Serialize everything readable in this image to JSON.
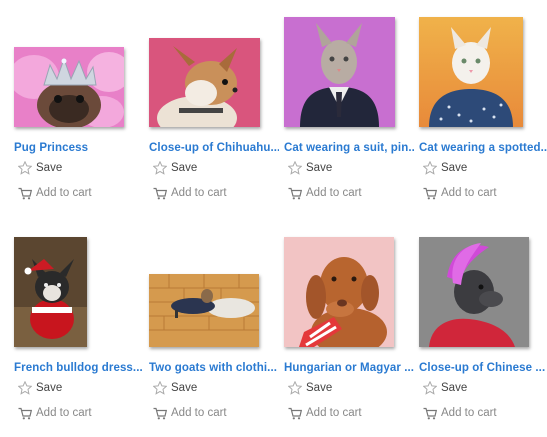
{
  "products": [
    {
      "title": "Pug Princess",
      "save_label": "Save",
      "cart_label": "Add to cart"
    },
    {
      "title": "Close-up of Chihuahu...",
      "save_label": "Save",
      "cart_label": "Add to cart"
    },
    {
      "title": "Cat wearing a suit, pin...",
      "save_label": "Save",
      "cart_label": "Add to cart"
    },
    {
      "title": "Cat wearing a spotted...",
      "save_label": "Save",
      "cart_label": "Add to cart"
    },
    {
      "title": "French bulldog dress...",
      "save_label": "Save",
      "cart_label": "Add to cart"
    },
    {
      "title": "Two goats with clothi...",
      "save_label": "Save",
      "cart_label": "Add to cart"
    },
    {
      "title": "Hungarian or Magyar ...",
      "save_label": "Save",
      "cart_label": "Add to cart"
    },
    {
      "title": "Close-up of Chinese ...",
      "save_label": "Save",
      "cart_label": "Add to cart"
    }
  ],
  "icons": {
    "save": "star-outline-icon",
    "cart": "shopping-cart-icon"
  },
  "colors": {
    "title_link": "#2a7ad1",
    "action_text": "#444444",
    "cart_text": "#888888",
    "star_stroke": "#aaaaaa"
  }
}
